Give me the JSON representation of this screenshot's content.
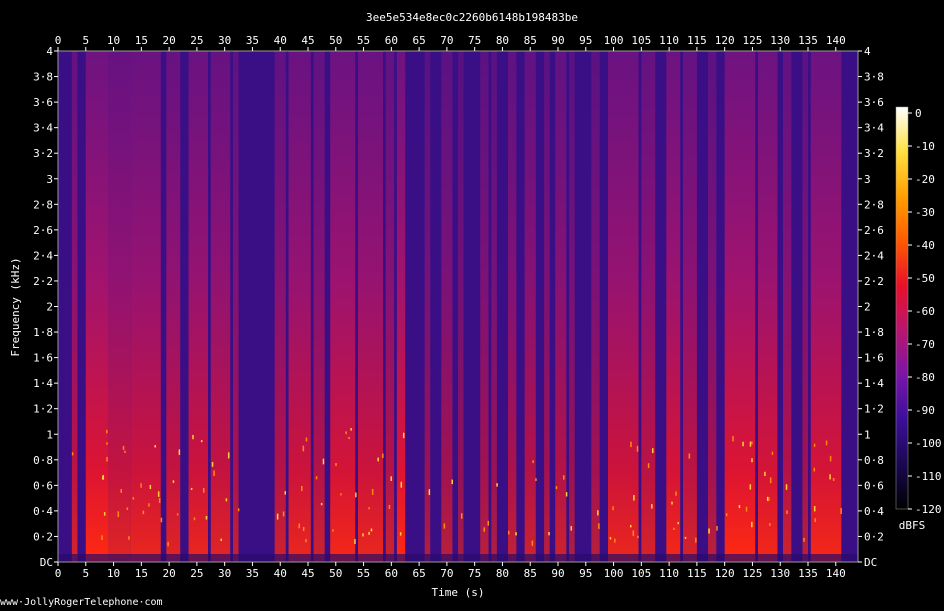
{
  "chart_data": {
    "type": "heatmap",
    "title": "3ee5e534e8ec0c2260b6148b198483be",
    "xlabel": "Time (s)",
    "ylabel": "Frequency (kHz)",
    "xlim": [
      0,
      144
    ],
    "ylim": [
      0,
      4
    ],
    "x_ticks": [
      "0",
      "5",
      "10",
      "15",
      "20",
      "25",
      "30",
      "35",
      "40",
      "45",
      "50",
      "55",
      "60",
      "65",
      "70",
      "75",
      "80",
      "85",
      "90",
      "95",
      "100",
      "105",
      "110",
      "115",
      "120",
      "125",
      "130",
      "135",
      "140"
    ],
    "y_ticks": [
      "DC",
      "0·2",
      "0·4",
      "0·6",
      "0·8",
      "1",
      "1·2",
      "1·4",
      "1·6",
      "1·8",
      "2",
      "2·2",
      "2·4",
      "2·6",
      "2·8",
      "3",
      "3·2",
      "3·4",
      "3·6",
      "3·8",
      "4"
    ],
    "colorbar": {
      "label": "dBFS",
      "ticks": [
        "0",
        "-10",
        "-20",
        "-30",
        "-40",
        "-50",
        "-60",
        "-70",
        "-80",
        "-90",
        "-100",
        "-110",
        "-120"
      ],
      "range": [
        -120,
        0
      ],
      "colors": [
        "#000000",
        "#1a0850",
        "#3b0f9a",
        "#7a15a8",
        "#b8166e",
        "#e8102a",
        "#ff5a00",
        "#ffa000",
        "#ffe040",
        "#ffffff"
      ]
    },
    "activity_segments_s": [
      [
        2.5,
        3.5,
        0.75
      ],
      [
        5,
        9,
        0.95
      ],
      [
        9,
        13,
        0.8
      ],
      [
        13,
        18.5,
        0.85
      ],
      [
        19.5,
        22,
        0.8
      ],
      [
        23.5,
        27,
        0.85
      ],
      [
        27.5,
        31,
        0.8
      ],
      [
        31.5,
        32.5,
        0.65
      ],
      [
        39,
        41,
        0.7
      ],
      [
        41.5,
        45.5,
        0.85
      ],
      [
        46,
        48,
        0.7
      ],
      [
        49,
        53.5,
        0.9
      ],
      [
        54,
        58.5,
        0.85
      ],
      [
        59,
        60.5,
        0.7
      ],
      [
        61,
        62.5,
        0.95
      ],
      [
        66,
        67,
        0.55
      ],
      [
        69,
        71,
        0.6
      ],
      [
        72,
        73,
        0.5
      ],
      [
        76,
        77.5,
        0.6
      ],
      [
        78,
        79,
        0.55
      ],
      [
        81,
        82.5,
        0.65
      ],
      [
        84,
        86,
        0.7
      ],
      [
        87.5,
        88.5,
        0.6
      ],
      [
        89.5,
        91.5,
        0.7
      ],
      [
        92,
        93,
        0.55
      ],
      [
        96,
        97.5,
        0.6
      ],
      [
        99,
        104.5,
        0.85
      ],
      [
        105,
        107.5,
        0.75
      ],
      [
        109.5,
        112,
        0.9
      ],
      [
        112.5,
        115,
        0.75
      ],
      [
        117,
        118.5,
        0.6
      ],
      [
        120,
        125.5,
        0.95
      ],
      [
        126,
        129.5,
        0.9
      ],
      [
        130.5,
        132,
        0.7
      ],
      [
        134,
        135,
        0.6
      ],
      [
        135.5,
        141,
        0.9
      ]
    ]
  },
  "watermark": "www·JollyRogerTelephone·com"
}
